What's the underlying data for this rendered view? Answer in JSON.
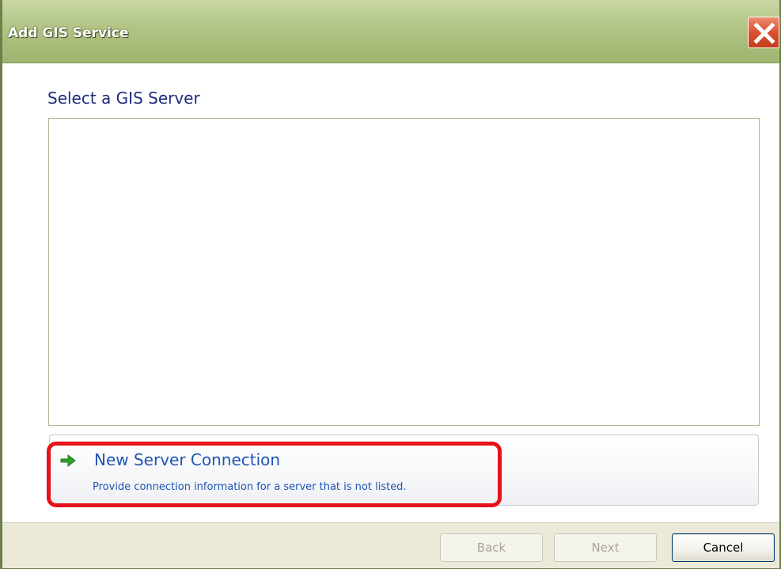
{
  "window": {
    "title": "Add GIS Service"
  },
  "main": {
    "heading": "Select a GIS Server",
    "servers": []
  },
  "new_connection": {
    "title": "New Server Connection",
    "description": "Provide connection information for a server that is not listed.",
    "icon": "green-arrow-right-icon"
  },
  "footer": {
    "back_label": "Back",
    "next_label": "Next",
    "cancel_label": "Cancel"
  },
  "colors": {
    "titlebar": "#b1c484",
    "heading": "#1f2b7e",
    "link": "#1f54b4",
    "highlight": "#e8111b",
    "close_button": "#d9522f"
  }
}
